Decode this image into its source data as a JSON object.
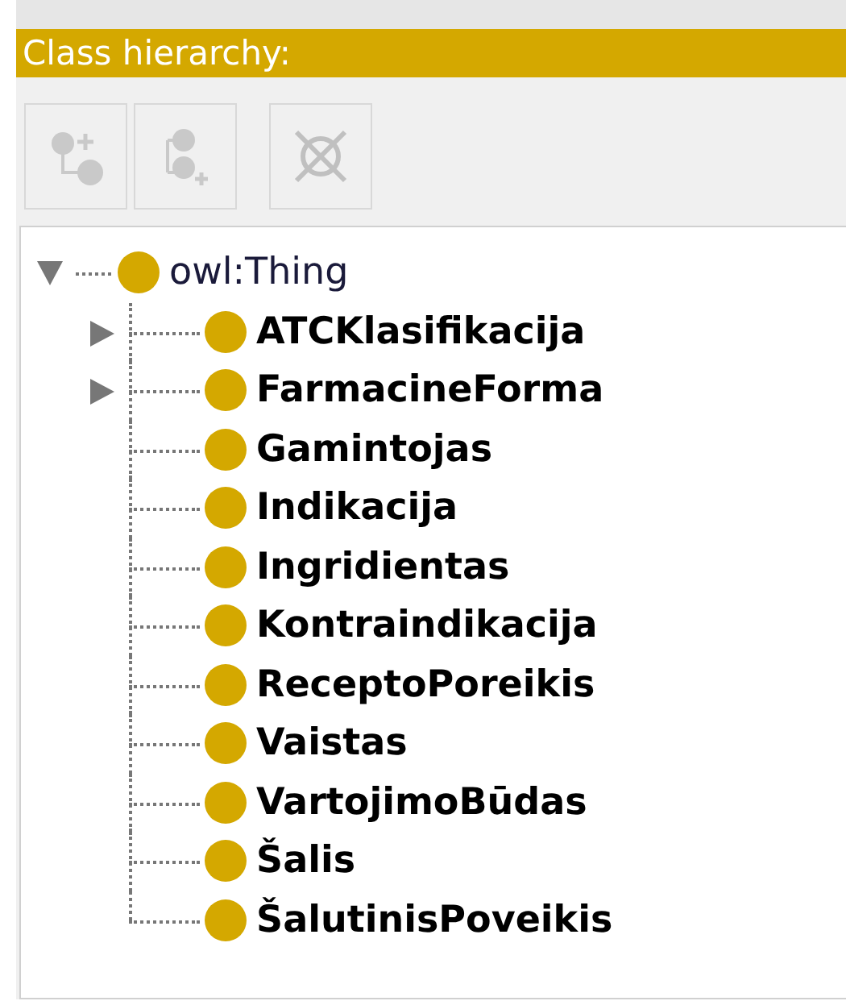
{
  "header": {
    "title": "Class hierarchy:"
  },
  "toolbar": [
    {
      "kind": "add-subclass",
      "disabled": true
    },
    {
      "kind": "add-sibling",
      "disabled": true
    },
    {
      "kind": "delete",
      "disabled": true
    }
  ],
  "tree": {
    "label": "owl:Thing",
    "expanded": true,
    "children": [
      {
        "label": "ATCKlasifikacija",
        "kind": "collapsed"
      },
      {
        "label": "FarmacineForma",
        "kind": "collapsed"
      },
      {
        "label": "Gamintojas",
        "kind": "leaf"
      },
      {
        "label": "Indikacija",
        "kind": "leaf"
      },
      {
        "label": "Ingridientas",
        "kind": "leaf"
      },
      {
        "label": "Kontraindikacija",
        "kind": "leaf"
      },
      {
        "label": "ReceptoPoreikis",
        "kind": "leaf"
      },
      {
        "label": "Vaistas",
        "kind": "leaf"
      },
      {
        "label": "VartojimoBūdas",
        "kind": "leaf"
      },
      {
        "label": "Šalis",
        "kind": "leaf"
      },
      {
        "label": "ŠalutinisPoveikis",
        "kind": "leaf"
      }
    ]
  }
}
